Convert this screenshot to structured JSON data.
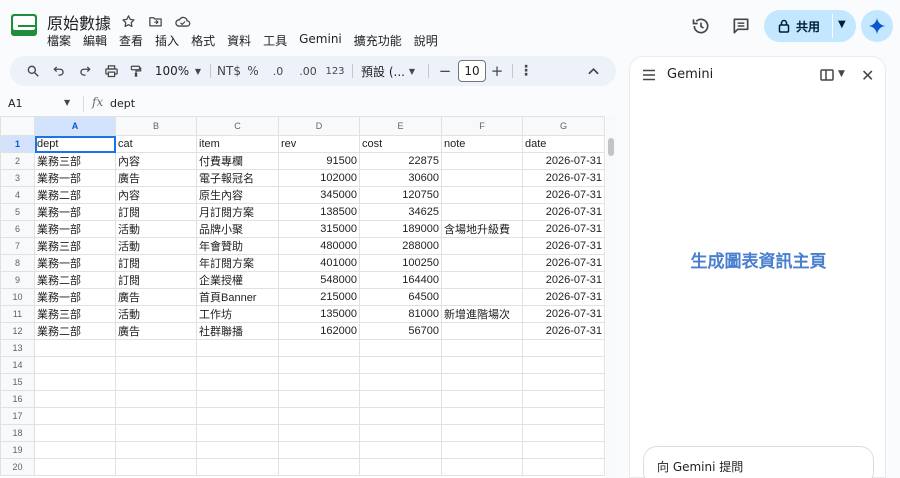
{
  "doc": {
    "title": "原始數據"
  },
  "menu": [
    "檔案",
    "編輯",
    "查看",
    "插入",
    "格式",
    "資料",
    "工具",
    "Gemini",
    "擴充功能",
    "說明"
  ],
  "share": {
    "label": "共用"
  },
  "toolbar": {
    "zoom": "100%",
    "currency": "NT$",
    "percent": "%",
    "dec_decrease": ".0",
    "dec_increase": ".00",
    "number_format": "123",
    "font": "預設 (...",
    "minus": "−",
    "font_size": "10",
    "plus": "+"
  },
  "formula_bar": {
    "cell_ref": "A1",
    "fx": "fx",
    "value": "dept"
  },
  "sheet": {
    "columns": [
      "A",
      "B",
      "C",
      "D",
      "E",
      "F",
      "G"
    ],
    "rows": [
      [
        "dept",
        "cat",
        "item",
        "rev",
        "cost",
        "note",
        "date"
      ],
      [
        "業務三部",
        "內容",
        "付費專欄",
        "91500",
        "22875",
        "",
        "2026-07-31"
      ],
      [
        "業務一部",
        "廣告",
        "電子報冠名",
        "102000",
        "30600",
        "",
        "2026-07-31"
      ],
      [
        "業務二部",
        "內容",
        "原生內容",
        "345000",
        "120750",
        "",
        "2026-07-31"
      ],
      [
        "業務一部",
        "訂閱",
        "月訂閱方案",
        "138500",
        "34625",
        "",
        "2026-07-31"
      ],
      [
        "業務一部",
        "活動",
        "品牌小聚",
        "315000",
        "189000",
        "含場地升級費",
        "2026-07-31"
      ],
      [
        "業務三部",
        "活動",
        "年會贊助",
        "480000",
        "288000",
        "",
        "2026-07-31"
      ],
      [
        "業務一部",
        "訂閱",
        "年訂閱方案",
        "401000",
        "100250",
        "",
        "2026-07-31"
      ],
      [
        "業務二部",
        "訂閱",
        "企業授權",
        "548000",
        "164400",
        "",
        "2026-07-31"
      ],
      [
        "業務一部",
        "廣告",
        "首頁Banner",
        "215000",
        "64500",
        "",
        "2026-07-31"
      ],
      [
        "業務三部",
        "活動",
        "工作坊",
        "135000",
        "81000",
        "新增進階場次",
        "2026-07-31"
      ],
      [
        "業務二部",
        "廣告",
        "社群聯播",
        "162000",
        "56700",
        "",
        "2026-07-31"
      ],
      [
        "",
        "",
        "",
        "",
        "",
        "",
        ""
      ],
      [
        "",
        "",
        "",
        "",
        "",
        "",
        ""
      ],
      [
        "",
        "",
        "",
        "",
        "",
        "",
        ""
      ],
      [
        "",
        "",
        "",
        "",
        "",
        "",
        ""
      ],
      [
        "",
        "",
        "",
        "",
        "",
        "",
        ""
      ],
      [
        "",
        "",
        "",
        "",
        "",
        "",
        ""
      ],
      [
        "",
        "",
        "",
        "",
        "",
        "",
        ""
      ],
      [
        "",
        "",
        "",
        "",
        "",
        "",
        ""
      ]
    ],
    "row_numbers": [
      "1",
      "2",
      "3",
      "4",
      "5",
      "6",
      "7",
      "8",
      "9",
      "10",
      "11",
      "12",
      "13",
      "14",
      "15",
      "16",
      "17",
      "18",
      "19",
      "20"
    ]
  },
  "gemini": {
    "title": "Gemini",
    "home_text": "生成圖表資訊主頁",
    "input_placeholder": "向 Gemini 提問"
  }
}
